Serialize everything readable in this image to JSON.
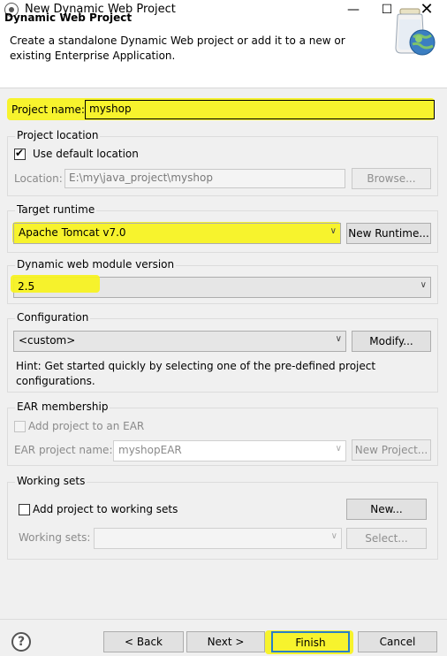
{
  "window": {
    "title": "New Dynamic Web Project"
  },
  "header": {
    "title": "Dynamic Web Project",
    "description": "Create a standalone Dynamic Web project or add it to a new or existing Enterprise Application."
  },
  "project_name": {
    "label": "Project name:",
    "value": "myshop"
  },
  "project_location": {
    "group_label": "Project location",
    "use_default_label": "Use default location",
    "use_default_checked": true,
    "location_label": "Location:",
    "location_value": "E:\\my\\java_project\\myshop",
    "browse_label": "Browse..."
  },
  "target_runtime": {
    "group_label": "Target runtime",
    "selected": "Apache Tomcat v7.0",
    "new_runtime_label": "New Runtime..."
  },
  "module_version": {
    "group_label": "Dynamic web module version",
    "selected": "2.5"
  },
  "configuration": {
    "group_label": "Configuration",
    "selected": "<custom>",
    "modify_label": "Modify...",
    "hint": "Hint: Get started quickly by selecting one of the pre-defined project configurations."
  },
  "ear": {
    "group_label": "EAR membership",
    "add_label": "Add project to an EAR",
    "ear_name_label": "EAR project name:",
    "ear_name_value": "myshopEAR",
    "new_project_label": "New Project..."
  },
  "working_sets": {
    "group_label": "Working sets",
    "add_label": "Add project to working sets",
    "new_label": "New...",
    "sets_label": "Working sets:",
    "select_label": "Select..."
  },
  "footer": {
    "help_glyph": "?",
    "back_label": "< Back",
    "next_label": "Next >",
    "finish_label": "Finish",
    "cancel_label": "Cancel"
  },
  "highlight_color": "#f7f31c"
}
